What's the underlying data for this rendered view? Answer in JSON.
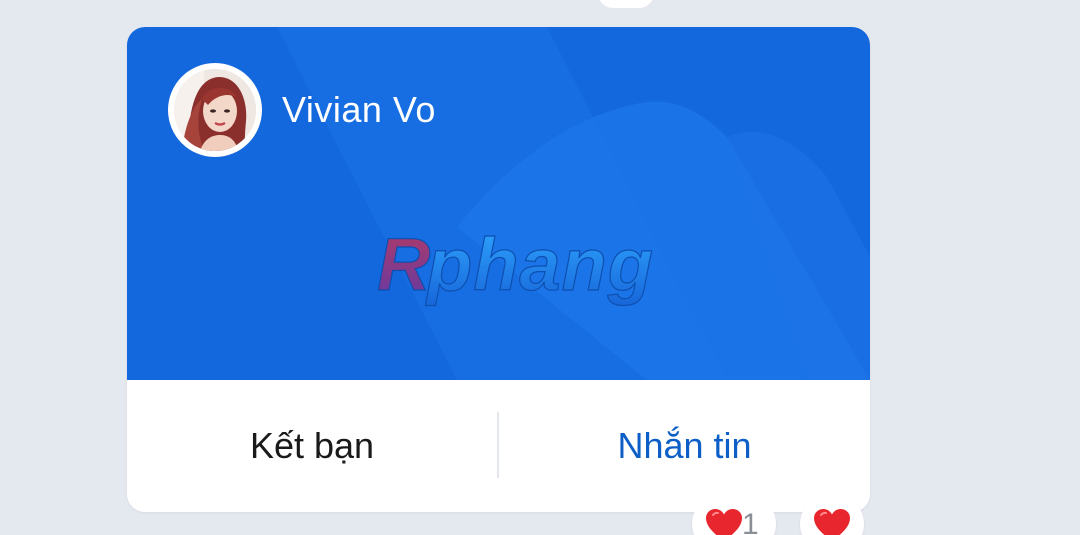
{
  "profile_card": {
    "name": "Vivian Vo",
    "watermark": "Rphang",
    "banner_color": "#1468dd",
    "actions": {
      "add_friend_label": "Kết bạn",
      "message_label": "Nhắn tin"
    }
  },
  "reactions": [
    {
      "icon": "heart-icon",
      "count": "1",
      "color": "#e8262d"
    },
    {
      "icon": "heart-icon",
      "count": "",
      "color": "#e8262d"
    }
  ],
  "colors": {
    "background": "#e4e8ef",
    "accent": "#0d5fc7",
    "heart": "#e8262d"
  }
}
